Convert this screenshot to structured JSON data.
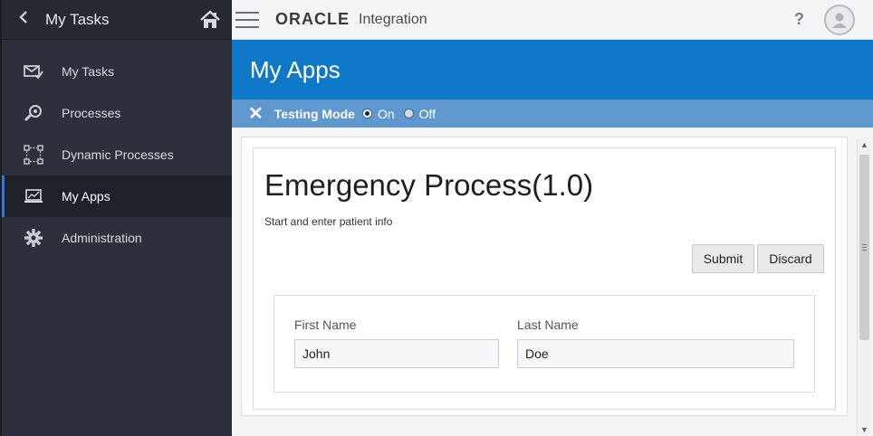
{
  "sidebar": {
    "title": "My Tasks",
    "back_icon": "chevron-left-icon",
    "home_icon": "home-icon",
    "items": [
      {
        "label": "My Tasks",
        "icon": "tasks-icon",
        "active": false
      },
      {
        "label": "Processes",
        "icon": "process-search-icon",
        "active": false
      },
      {
        "label": "Dynamic Processes",
        "icon": "dynamic-process-icon",
        "active": false
      },
      {
        "label": "My Apps",
        "icon": "apps-monitor-icon",
        "active": true
      },
      {
        "label": "Administration",
        "icon": "gear-icon",
        "active": false
      }
    ]
  },
  "topbar": {
    "brand": "ORACLE",
    "product": "Integration",
    "help": "?"
  },
  "page": {
    "title": "My Apps"
  },
  "testing": {
    "close": "✕",
    "label": "Testing Mode",
    "on_label": "On",
    "off_label": "Off",
    "selected": "On"
  },
  "form": {
    "title": "Emergency Process(1.0)",
    "subtitle": "Start and enter patient info",
    "submit_label": "Submit",
    "discard_label": "Discard",
    "first_name_label": "First Name",
    "first_name_value": "John",
    "last_name_label": "Last Name",
    "last_name_value": "Doe"
  },
  "colors": {
    "sidebar_bg": "#2d303a",
    "header_blue": "#0f78c8",
    "testing_bar": "#5f98cf",
    "active_accent": "#2c7be5"
  }
}
